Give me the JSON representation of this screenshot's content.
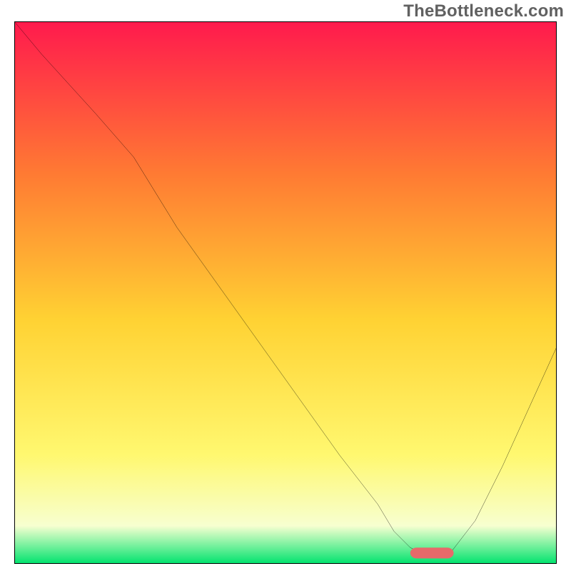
{
  "watermark": "TheBottleneck.com",
  "chart_data": {
    "type": "line",
    "title": "",
    "xlabel": "",
    "ylabel": "",
    "xlim": [
      0,
      100
    ],
    "ylim": [
      0,
      100
    ],
    "grid": false,
    "legend": false,
    "background_gradient": {
      "top_color": "#ff1a4d",
      "upper_mid_color": "#ff7a33",
      "mid_color": "#ffd233",
      "lower_mid_color": "#fff870",
      "near_bottom_color": "#f7ffd0",
      "bottom_color": "#00e36e"
    },
    "series": [
      {
        "name": "curve",
        "color": "#000000",
        "width": 2,
        "x": [
          0,
          5,
          15,
          22,
          30,
          40,
          50,
          60,
          67,
          70,
          73,
          76,
          80,
          85,
          90,
          95,
          100
        ],
        "y": [
          100,
          94,
          83,
          75,
          62,
          48,
          34,
          20,
          11,
          6,
          3,
          1.5,
          1.5,
          8,
          18,
          29,
          40
        ]
      }
    ],
    "marker": {
      "name": "minimum-marker",
      "color": "#e76a6a",
      "radius": 2.0,
      "x_range": [
        73,
        81
      ],
      "y": 2.0
    }
  }
}
